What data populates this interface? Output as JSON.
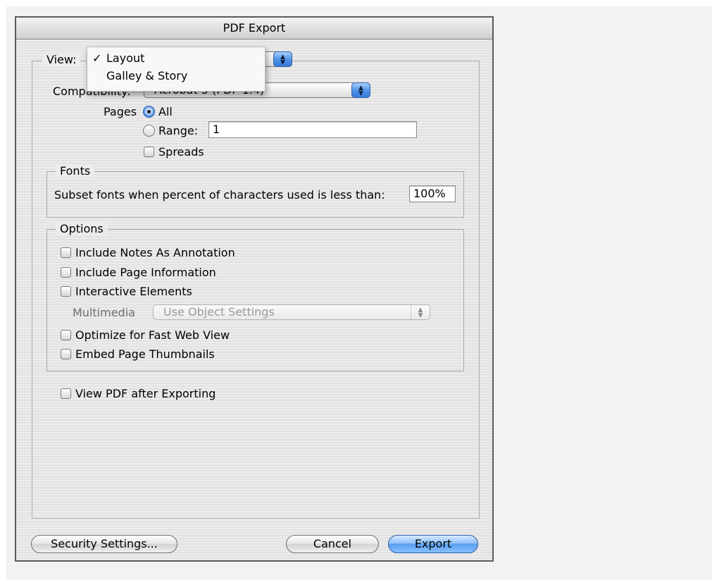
{
  "window": {
    "title": "PDF Export"
  },
  "view": {
    "label": "View:",
    "menu_items": [
      {
        "label": "Layout",
        "checkmark": "✓"
      },
      {
        "label": "Galley & Story"
      }
    ]
  },
  "compatibility": {
    "label": "Compatibility:",
    "value": "Acrobat 5 (PDF 1.4)"
  },
  "pages": {
    "label": "Pages",
    "all_label": "All",
    "range_label": "Range:",
    "range_value": "1",
    "spreads_label": "Spreads"
  },
  "fonts": {
    "legend": "Fonts",
    "subset_label": "Subset fonts when percent of characters used is less than:",
    "subset_value": "100%"
  },
  "options": {
    "legend": "Options",
    "include_notes": "Include Notes As Annotation",
    "include_page_info": "Include Page Information",
    "interactive_elements": "Interactive Elements",
    "multimedia_label": "Multimedia",
    "multimedia_value": "Use Object Settings",
    "fast_web_view": "Optimize for Fast Web View",
    "embed_thumbnails": "Embed Page Thumbnails"
  },
  "view_pdf_after": "View PDF after Exporting",
  "buttons": {
    "security": "Security Settings...",
    "cancel": "Cancel",
    "export": "Export"
  },
  "stepper_glyph": "▲▼",
  "colors": {
    "accent": "#4c8fe6",
    "default_button": "#5a9ef0"
  }
}
